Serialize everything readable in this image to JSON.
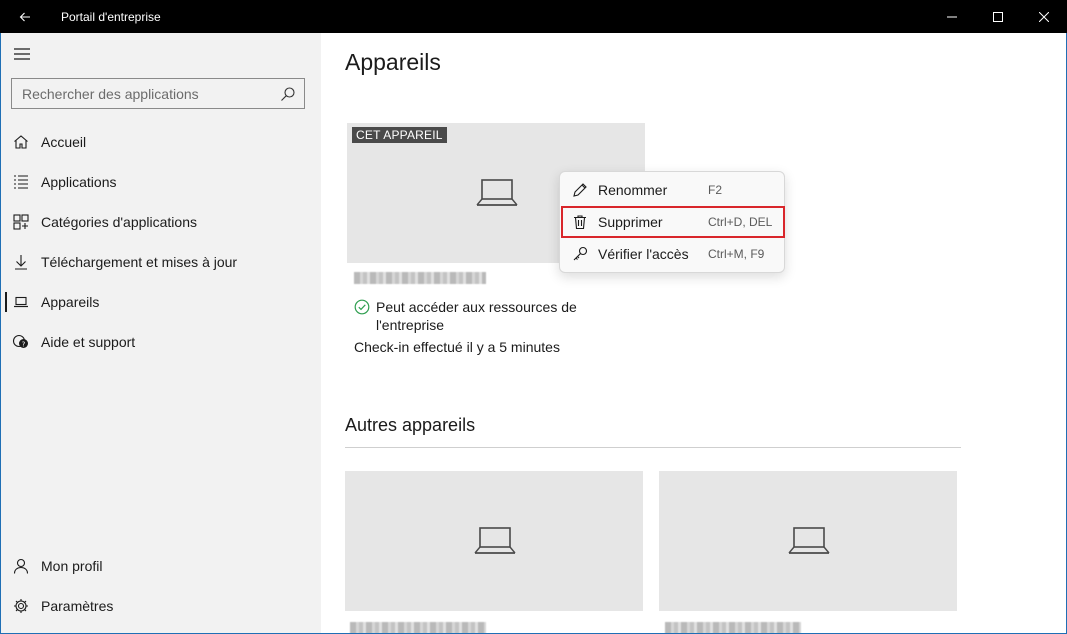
{
  "window": {
    "title": "Portail d'entreprise",
    "back_icon": "back-arrow-icon",
    "controls": [
      "minimize-icon",
      "maximize-icon",
      "close-icon"
    ]
  },
  "sidebar": {
    "search_placeholder": "Rechercher des applications",
    "nav_items": [
      {
        "label": "Accueil",
        "icon": "home-icon"
      },
      {
        "label": "Applications",
        "icon": "list-icon"
      },
      {
        "label": "Catégories d'applications",
        "icon": "categories-icon"
      },
      {
        "label": "Téléchargement et mises à jour",
        "icon": "download-icon"
      },
      {
        "label": "Appareils",
        "icon": "laptop-icon",
        "active": true
      },
      {
        "label": "Aide et support",
        "icon": "help-chat-icon"
      }
    ],
    "bottom_items": [
      {
        "label": "Mon profil",
        "icon": "person-icon"
      },
      {
        "label": "Paramètres",
        "icon": "gear-icon"
      }
    ]
  },
  "main": {
    "title": "Appareils",
    "this_device": {
      "badge": "CET APPAREIL",
      "status": "Peut accéder aux ressources de l'entreprise",
      "checkin": "Check-in effectué il y a 5 minutes"
    },
    "other_devices_title": "Autres appareils"
  },
  "context_menu": {
    "items": [
      {
        "label": "Renommer",
        "shortcut": "F2",
        "icon": "pencil-icon"
      },
      {
        "label": "Supprimer",
        "shortcut": "Ctrl+D, DEL",
        "icon": "trash-icon",
        "highlighted": true
      },
      {
        "label": "Vérifier l'accès",
        "shortcut": "Ctrl+M, F9",
        "icon": "key-icon"
      }
    ]
  },
  "colors": {
    "titlebar": "#000000",
    "sidebar_bg": "#f2f2f2",
    "card_bg": "#e6e6e6",
    "badge_bg": "#4a4a4a",
    "highlight_outline": "#d9262b",
    "status_check": "#2e9e4f"
  }
}
